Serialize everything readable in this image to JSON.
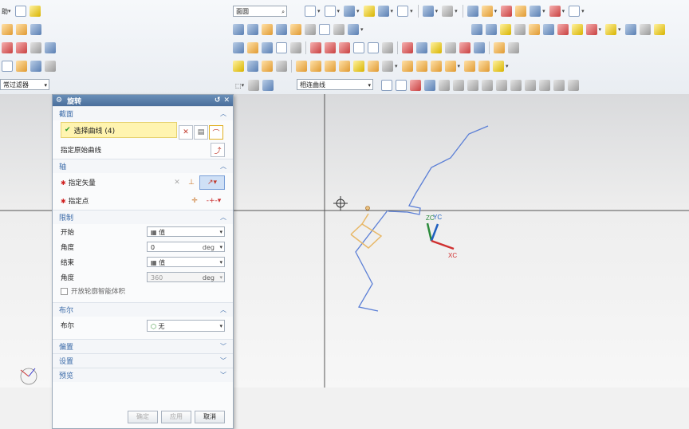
{
  "toolbar": {
    "row1_left": "助",
    "search_value": "面圆",
    "filter_combo": "常过滤器",
    "curve_rule_combo": "相连曲线"
  },
  "dialog": {
    "title": "旋转",
    "sections": {
      "section": "截面",
      "axis": "轴",
      "limits": "限制",
      "boolean": "布尔",
      "offset": "偏置",
      "settings": "设置",
      "preview": "预览"
    },
    "select_curve": "选择曲线 (4)",
    "specify_origin_curve": "指定原始曲线",
    "specify_vector": "指定矢量",
    "specify_point": "指定点",
    "start_label": "开始",
    "start_value": "值",
    "angle1_label": "角度",
    "angle1_value": "0",
    "end_label": "结束",
    "end_value": "值",
    "angle2_label": "角度",
    "angle2_value": "360",
    "unit": "deg",
    "open_profile": "开放轮廓智能体积",
    "boolean_label": "布尔",
    "boolean_value": "无",
    "ok": "确定",
    "apply": "应用",
    "cancel": "取消"
  },
  "triad": {
    "zc": "ZC",
    "yc": "YC",
    "xc": "XC"
  },
  "colors": {
    "curve": "#5b7fd6",
    "selected": "#e8b868",
    "axis_z": "#2a8a3a",
    "axis_x": "#d03030",
    "axis_y": "#2060c0"
  }
}
